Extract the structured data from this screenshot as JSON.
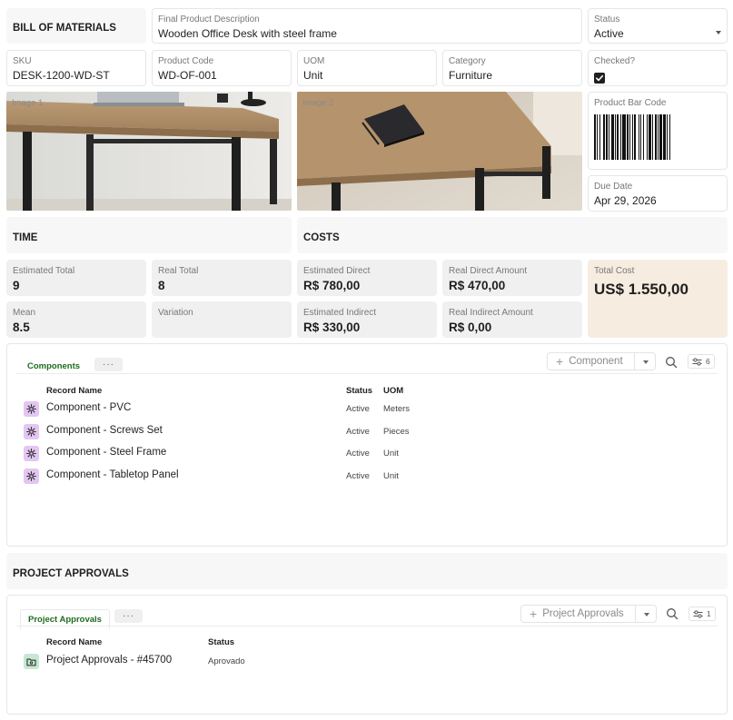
{
  "header": {
    "title": "BILL OF MATERIALS",
    "description_label": "Final Product Description",
    "description_value": "Wooden Office Desk with steel frame",
    "status_label": "Status",
    "status_value": "Active"
  },
  "fields": {
    "sku_label": "SKU",
    "sku_value": "DESK-1200-WD-ST",
    "product_code_label": "Product Code",
    "product_code_value": "WD-OF-001",
    "uom_label": "UOM",
    "uom_value": "Unit",
    "category_label": "Category",
    "category_value": "Furniture",
    "checked_label": "Checked?"
  },
  "images": {
    "image1_label": "Image 1",
    "image2_label": "Image 2",
    "barcode_label": "Product Bar Code",
    "due_date_label": "Due Date",
    "due_date_value": "Apr 29, 2026"
  },
  "time": {
    "title": "TIME",
    "estimated_total_label": "Estimated Total",
    "estimated_total_value": "9",
    "real_total_label": "Real Total",
    "real_total_value": "8",
    "mean_label": "Mean",
    "mean_value": "8.5",
    "variation_label": "Variation"
  },
  "costs": {
    "title": "COSTS",
    "estimated_direct_label": "Estimated Direct",
    "estimated_direct_value": "R$ 780,00",
    "real_direct_label": "Real Direct Amount",
    "real_direct_value": "R$ 470,00",
    "estimated_indirect_label": "Estimated Indirect",
    "estimated_indirect_value": "R$ 330,00",
    "real_indirect_label": "Real Indirect Amount",
    "real_indirect_value": "R$ 0,00",
    "total_cost_label": "Total Cost",
    "total_cost_value": "US$ 1.550,00"
  },
  "components": {
    "tab_label": "Components",
    "more_label": "···",
    "add_button_label": "Component",
    "filter_count": "6",
    "col_name": "Record Name",
    "col_status": "Status",
    "col_uom": "UOM",
    "rows": [
      {
        "name": "Component - PVC",
        "status": "Active",
        "uom": "Meters"
      },
      {
        "name": "Component - Screws Set",
        "status": "Active",
        "uom": "Pieces"
      },
      {
        "name": "Component - Steel Frame",
        "status": "Active",
        "uom": "Unit"
      },
      {
        "name": "Component - Tabletop Panel",
        "status": "Active",
        "uom": "Unit"
      }
    ]
  },
  "approvals": {
    "section_title": "PROJECT APPROVALS",
    "tab_label": "Project Approvals",
    "more_label": "···",
    "add_button_label": "Project Approvals",
    "filter_count": "1",
    "col_name": "Record Name",
    "col_status": "Status",
    "rows": [
      {
        "name": "Project Approvals - #45700",
        "status": "Aprovado"
      }
    ]
  },
  "colors": {
    "accent_green": "#1e6b1e",
    "component_icon_bg": "#e3c6f2",
    "approval_icon_bg": "#c6e8d2",
    "total_cost_bg": "#f7ece0"
  },
  "icons": {
    "component_row": "gear-icon",
    "approval_row": "folder-icon",
    "search": "search-icon",
    "filter": "sliders-icon",
    "add": "plus-icon"
  }
}
